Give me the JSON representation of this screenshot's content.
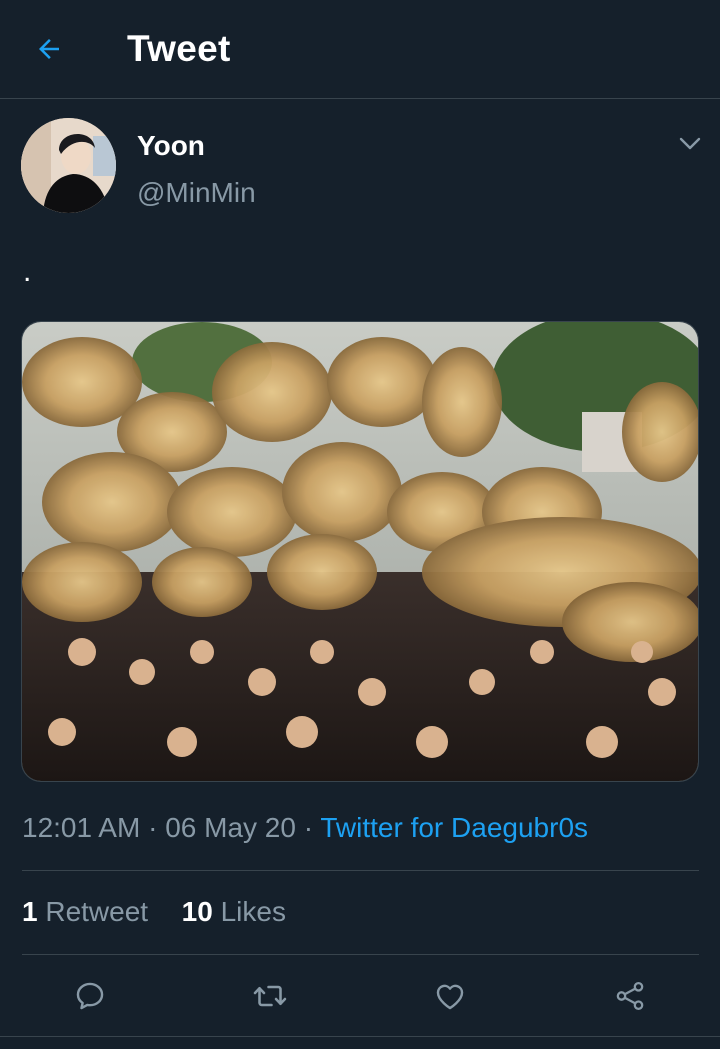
{
  "header": {
    "title": "Tweet",
    "back_icon": "arrow-left-icon"
  },
  "author": {
    "name": "Yoon",
    "handle": "@MinMin",
    "caret_icon": "chevron-down-icon"
  },
  "tweet": {
    "text": "."
  },
  "meta": {
    "time": "12:01 AM",
    "sep1": " · ",
    "date": "06 May 20",
    "sep2": " · ",
    "source": "Twitter for Daegubr0s"
  },
  "stats": {
    "retweets_count": "1",
    "retweets_label": "Retweet",
    "likes_count": "10",
    "likes_label": "Likes"
  },
  "actions": [
    {
      "name": "reply",
      "icon": "reply-icon"
    },
    {
      "name": "retweet",
      "icon": "retweet-icon"
    },
    {
      "name": "like",
      "icon": "heart-icon"
    },
    {
      "name": "share",
      "icon": "share-icon"
    }
  ],
  "colors": {
    "background": "#15202b",
    "accent": "#1da1f2",
    "secondary_text": "#8899a6",
    "divider": "#38444d"
  }
}
